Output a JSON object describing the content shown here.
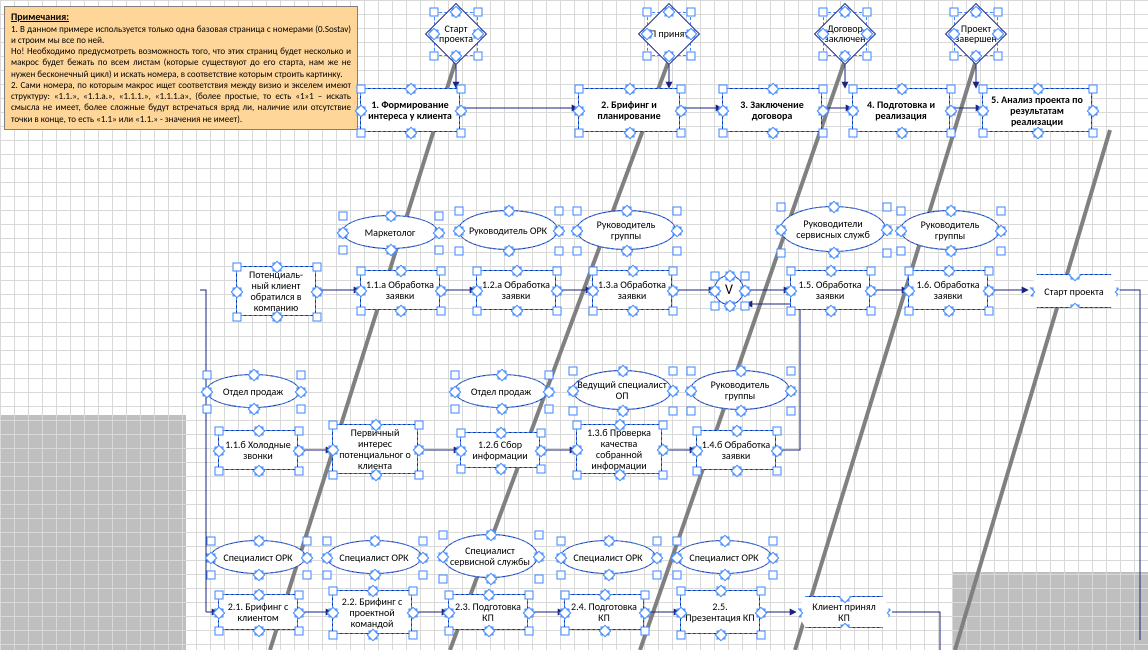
{
  "note": {
    "title": "Примечания:",
    "p1": "1. В данном примере используется только одна базовая страница с номерами (0.Sostav) и строим мы все по ней.",
    "p2": "Но! Необходимо предусмотреть возможность того, что этих страниц будет несколько и макрос будет бежать по всем листам (которые существуют до его старта, нам же не нужен бесконечный цикл) и искать номера, в соответствие которым строить картинку.",
    "p3": "2. Сами номера, по которым макрос ищет соответствия между визио и экселем имеют структуру: «1.1.», «1.1.а.», «1.1.1.», «1.1.1.а», (более простые, то есть «1»1 – искать смысла не имеет, более сложные будут встречаться вряд ли, наличие или отсутствие точки в конце, то есть «1.1» или «1.1.» - значения не имеет)."
  },
  "diamonds": {
    "d1": "Старт проекта",
    "d2": "КП принято",
    "d3": "Договор заключен",
    "d4": "Проект завершен"
  },
  "phases": {
    "p1": "1. Формирование интереса у клиента",
    "p2": "2. Брифинг и планирование",
    "p3": "3. Заключение договора",
    "p4": "4. Подготовка и реализация",
    "p5": "5. Анализ проекта по результатам реализации"
  },
  "rolesRow1": {
    "r1": "Маркетолог",
    "r2": "Руководитель ОРК",
    "r3": "Руководитель группы",
    "r4": "Руководители сервисных служб",
    "r5": "Руководитель группы"
  },
  "row1": {
    "start": "Потенциаль-ный клиент обратился в компанию",
    "a1": "1.1.а Обработка заявки",
    "a2": "1.2.а Обработка заявки",
    "a3": "1.3.а Обработка заявки",
    "gate": "V",
    "a5": "1.5. Обработка заявки",
    "a6": "1.6. Обработка заявки",
    "end": "Старт проекта"
  },
  "rolesRow2": {
    "r1": "Отдел продаж",
    "r2": "Отдел продаж",
    "r3": "Ведущий специалист ОП",
    "r4": "Руководитель группы"
  },
  "row2": {
    "b1": "1.1.б Холодные звонки",
    "b2": "Первичный интерес потенциальног о клиента",
    "b3": "1.2.б Сбор информации",
    "b4": "1.3.б Проверка качества собранной информации",
    "b5": "1.4.б Обработка заявки"
  },
  "rolesRow3": {
    "r1": "Специалист ОРК",
    "r2": "Специалист ОРК",
    "r3": "Специалист сервисной службы",
    "r4": "Специалист ОРК",
    "r5": "Специалист ОРК"
  },
  "row3": {
    "c1": "2.1. Брифинг с клиентом",
    "c2": "2.2. Брифинг с проектной командой",
    "c3": "2.3. Подготовка КП",
    "c4": "2.4. Подготовка КП",
    "c5": "2.5. Презентация КП",
    "end": "Клиент принял КП"
  }
}
